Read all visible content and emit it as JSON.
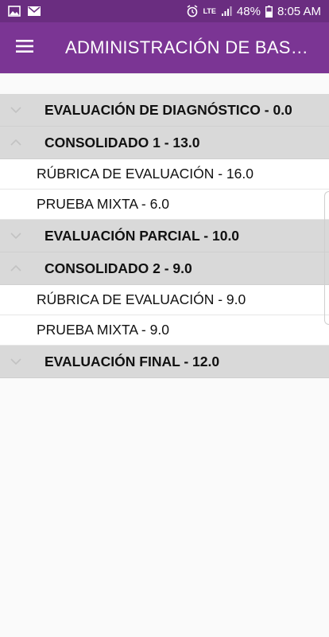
{
  "status_bar": {
    "left_icons": [
      "image-icon",
      "mail-icon"
    ],
    "right_icons": [
      "alarm-icon",
      "lte-icon",
      "signal-icon",
      "battery-icon"
    ],
    "network": "LTE",
    "battery_percent": "48%",
    "time": "8:05 AM"
  },
  "appbar": {
    "title": "ADMINISTRACIÓN DE BASE…",
    "menu_icon": "menu-icon"
  },
  "list": {
    "group1": {
      "label": "EVALUACIÓN DE DIAGNÓSTICO - 0.0",
      "state": "collapsed"
    },
    "group2": {
      "label": "CONSOLIDADO 1 - 13.0",
      "state": "expanded",
      "items": [
        "RÚBRICA DE EVALUACIÓN - 16.0",
        "PRUEBA MIXTA - 6.0"
      ]
    },
    "group3": {
      "label": "EVALUACIÓN PARCIAL - 10.0",
      "state": "collapsed"
    },
    "group4": {
      "label": "CONSOLIDADO 2 - 9.0",
      "state": "expanded",
      "items": [
        "RÚBRICA DE EVALUACIÓN - 9.0",
        "PRUEBA MIXTA - 9.0"
      ]
    },
    "group5": {
      "label": "EVALUACIÓN FINAL - 12.0",
      "state": "collapsed"
    }
  },
  "colors": {
    "appbar": "#7b3594",
    "status_bar": "#6a2d80",
    "group_bg": "#d9d9d9",
    "item_bg": "#ffffff"
  }
}
